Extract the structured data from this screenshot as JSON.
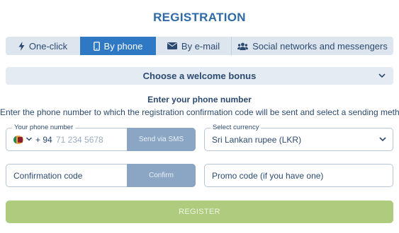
{
  "page": {
    "title": "REGISTRATION"
  },
  "tabs": [
    {
      "label": "One-click",
      "icon": "lightning-icon",
      "active": false
    },
    {
      "label": "By phone",
      "icon": "phone-icon",
      "active": true
    },
    {
      "label": "By e-mail",
      "icon": "envelope-icon",
      "active": false
    },
    {
      "label": "Social networks and messengers",
      "icon": "users-icon",
      "active": false
    }
  ],
  "bonus": {
    "label": "Choose a welcome bonus"
  },
  "phone_section": {
    "heading": "Enter your phone number",
    "description": "Enter the phone number to which the registration confirmation code will be sent and select a sending method"
  },
  "phone_field": {
    "legend": "Your phone number",
    "country_code": "+ 94",
    "placeholder": "71 234 5678",
    "send_button": "Send via SMS"
  },
  "currency_field": {
    "legend": "Select currency",
    "value": "Sri Lankan rupee (LKR)"
  },
  "confirmation_field": {
    "placeholder": "Confirmation code",
    "button": "Confirm"
  },
  "promo_field": {
    "placeholder": "Promo code (if you have one)"
  },
  "register_button": {
    "label": "REGISTER"
  },
  "colors": {
    "accent": "#2f78c4",
    "title": "#2e6aa6",
    "text": "#2c4a70",
    "disabled_button": "#8aa6c4",
    "register": "#aecb7e"
  }
}
